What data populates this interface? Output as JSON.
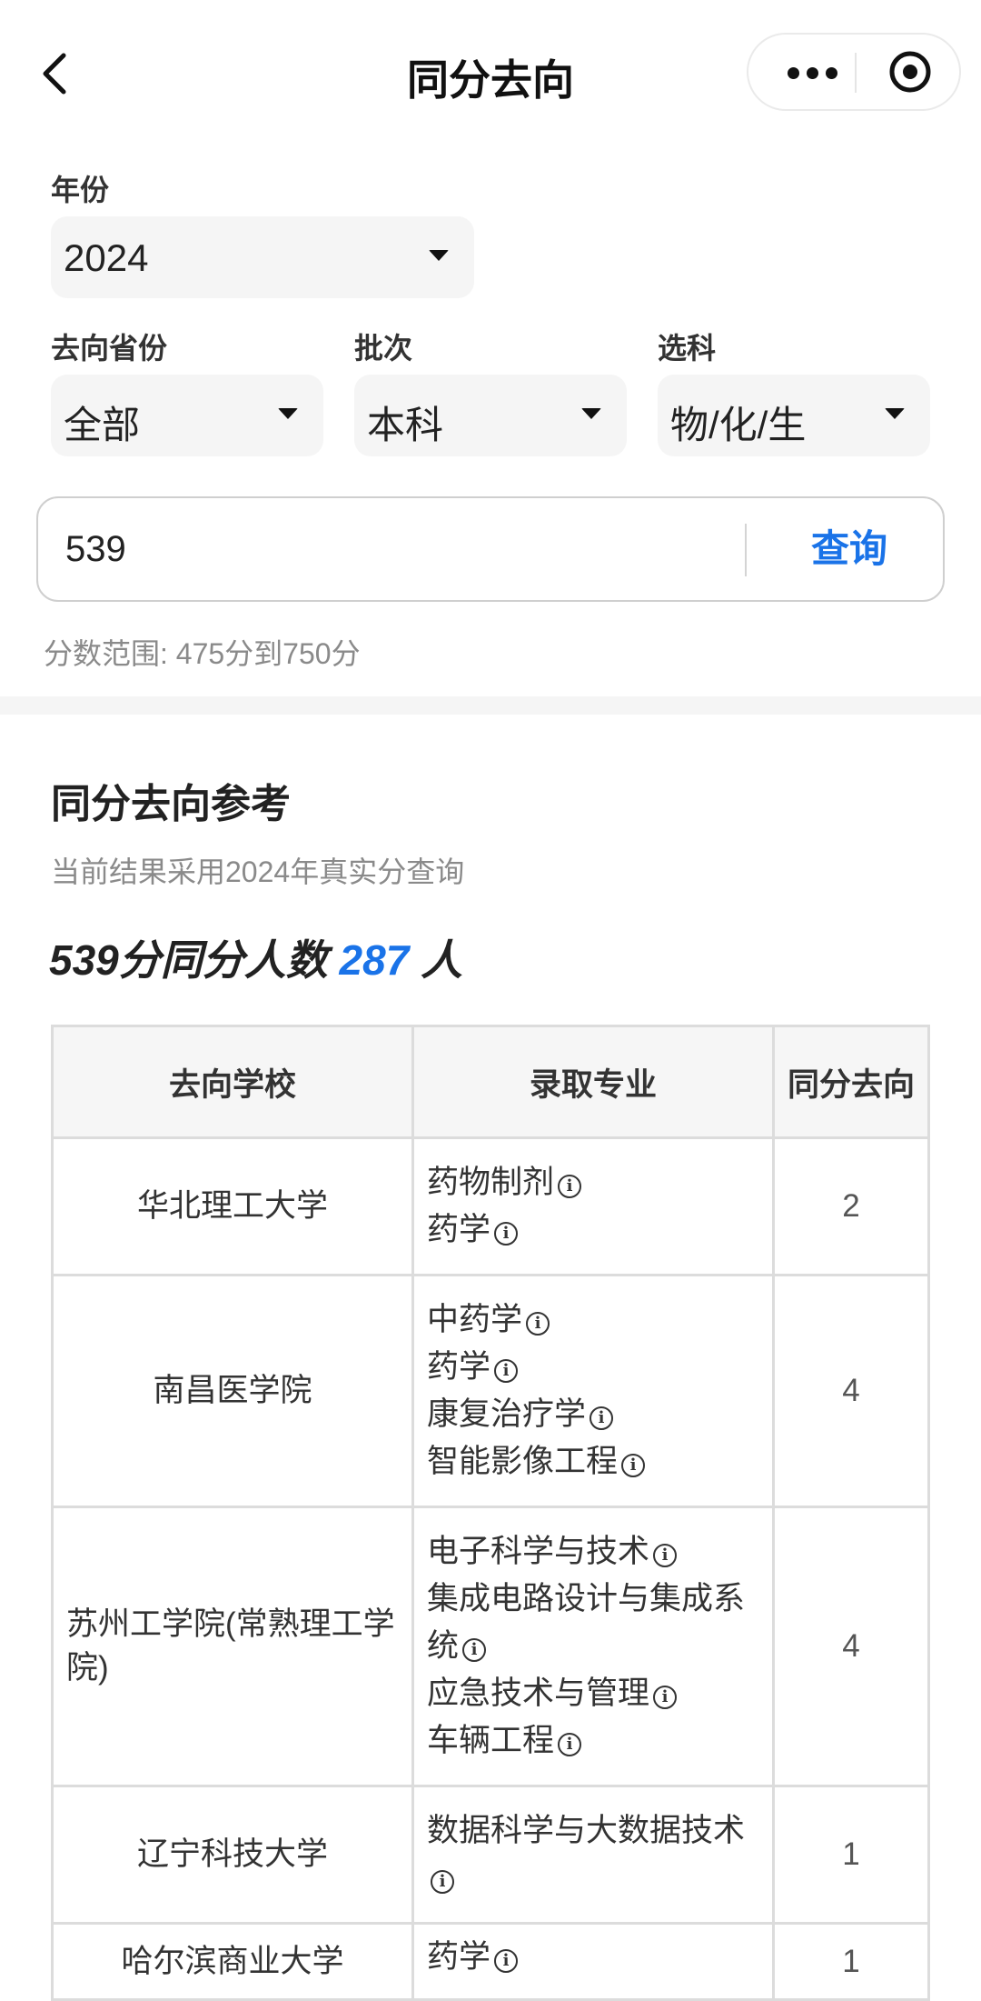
{
  "nav": {
    "title": "同分去向"
  },
  "filters": {
    "year": {
      "label": "年份",
      "value": "2024"
    },
    "province": {
      "label": "去向省份",
      "value": "全部"
    },
    "batch": {
      "label": "批次",
      "value": "本科"
    },
    "subjects": {
      "label": "选科",
      "value": "物/化/生"
    }
  },
  "search": {
    "value": "539",
    "button_label": "查询",
    "hint": "分数范围: 475分到750分"
  },
  "section": {
    "title": "同分去向参考",
    "subtitle": "当前结果采用2024年真实分查询",
    "count_prefix": "539分同分人数",
    "count_value": "287",
    "count_suffix": "人"
  },
  "table": {
    "headers": [
      "去向学校",
      "录取专业",
      "同分去向"
    ],
    "rows": [
      {
        "school": "华北理工大学",
        "majors": [
          "药物制剂",
          "药学"
        ],
        "count": "2"
      },
      {
        "school": "南昌医学院",
        "majors": [
          "中药学",
          "药学",
          "康复治疗学",
          "智能影像工程"
        ],
        "count": "4"
      },
      {
        "school": "苏州工学院(常熟理工学院)",
        "majors": [
          "电子科学与技术",
          "集成电路设计与集成系统",
          "应急技术与管理",
          "车辆工程"
        ],
        "count": "4"
      },
      {
        "school": "辽宁科技大学",
        "majors": [
          "数据科学与大数据技术"
        ],
        "count": "1"
      },
      {
        "school": "哈尔滨商业大学",
        "majors": [
          "药学"
        ],
        "count": "1"
      }
    ]
  },
  "icons": {
    "info": "info-icon",
    "back": "back-arrow-icon",
    "more": "more-dots-icon",
    "target": "close-target-icon"
  },
  "colors": {
    "accent": "#1a73e8"
  }
}
